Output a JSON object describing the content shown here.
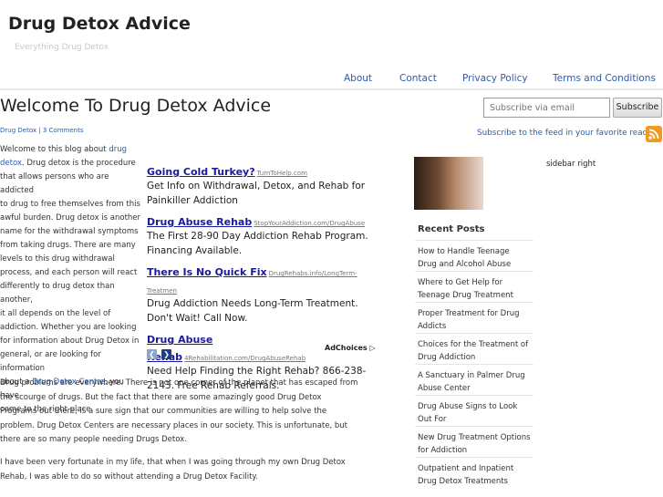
{
  "site": {
    "title": "Drug Detox Advice",
    "tagline": "Everything Drug Detox"
  },
  "nav": [
    {
      "label": "About"
    },
    {
      "label": "Contact"
    },
    {
      "label": "Privacy Policy"
    },
    {
      "label": "Terms and Conditions"
    }
  ],
  "post": {
    "title": "Welcome To Drug Detox Advice",
    "category": "Drug Detox",
    "separator": " | ",
    "comments": "3 Comments",
    "intro_lines": [
      {
        "text": "Welcome to this blog about ",
        "link": "drug"
      },
      {
        "link": "detox",
        "text": ". Drug detox is the procedure"
      },
      {
        "text": "that allows persons who are addicted"
      },
      {
        "text": "to drug to free themselves from this"
      },
      {
        "text": "awful burden. Drug detox is another"
      },
      {
        "text": "name for the withdrawal symptoms"
      },
      {
        "text": "from taking drugs. There are many"
      },
      {
        "text": "levels to this drug withdrawal"
      },
      {
        "text": "process, and each person will react"
      },
      {
        "text": "differently to drug detox than another,"
      },
      {
        "text": "it all depends on the level of"
      },
      {
        "text": "addiction. Whether you are looking"
      },
      {
        "text": "for information about Drug Detox in"
      },
      {
        "text": "general, or are looking for information"
      },
      {
        "text": "about a ",
        "link": "Drug Detox Centre",
        "after": ", you have"
      },
      {
        "text": "come to the right place."
      }
    ],
    "para2": "Drug problems are everywhere. There is not one corner of the planet that has escaped from the scourge of drugs. But the fact that there are some amazingly good Drug Detox Programs out there, is a sure sign that our communities are willing to help solve the problem. Drug Detox Centers are necessary places in our society. This is unfortunate, but there are so many people needing Drugs Detox.",
    "para3": "I have been very fortunate in my life, that when I was going through my own Drug Detox Rehab, I was able to do so without attending a Drug Detox Facility."
  },
  "subscribe": {
    "placeholder": "Subscribe via email",
    "button": "Subscribe",
    "feed_text": "Subscribe to the feed in your favorite reader"
  },
  "ads": {
    "items": [
      {
        "title": "Going Cold Turkey?",
        "url": "TurnToHelp.com",
        "desc": "Get Info on Withdrawal, Detox, and Rehab for Painkiller Addiction"
      },
      {
        "title": "Drug Abuse Rehab",
        "url": "StopYourAddiction.com/DrugAbuse",
        "desc": "The First 28-90 Day Addiction Rehab Program. Financing Available."
      },
      {
        "title": "There Is No Quick Fix",
        "url": "DrugRehabs.info/LongTerm-Treatmen",
        "desc": "Drug Addiction Needs Long-Term Treatment. Don't Wait! Call Now."
      },
      {
        "title": "Drug Abuse Rehab",
        "url": "4Rehabilitation.com/DrugAbuseRehab",
        "desc": "Need Help Finding the Right Rehab? 866-238-2143. Free Rehab Referrals."
      }
    ],
    "prev_icon": "chevron-left-icon",
    "next_icon": "chevron-right-icon",
    "choices_label": "AdChoices",
    "prev_color": "#8fa6cc",
    "next_color": "#1d3f8a"
  },
  "sidebar": {
    "right_label": "sidebar right",
    "recent_heading": "Recent Posts",
    "recent_posts": [
      "How to Handle Teenage Drug and Alcohol Abuse",
      "Where to Get Help for Teenage Drug Treatment",
      "Proper Treatment for Drug Addicts",
      "Choices for the Treatment of Drug Addiction",
      "A Sanctuary in Palmer Drug Abuse Center",
      "Drug Abuse Signs to Look Out For",
      "New Drug Treatment Options for Addiction",
      "Outpatient and Inpatient Drug Detox Treatments"
    ]
  },
  "colors": {
    "link": "#2a5db0",
    "ad_title": "#1a1a9c",
    "rss": "#f29a1f"
  }
}
